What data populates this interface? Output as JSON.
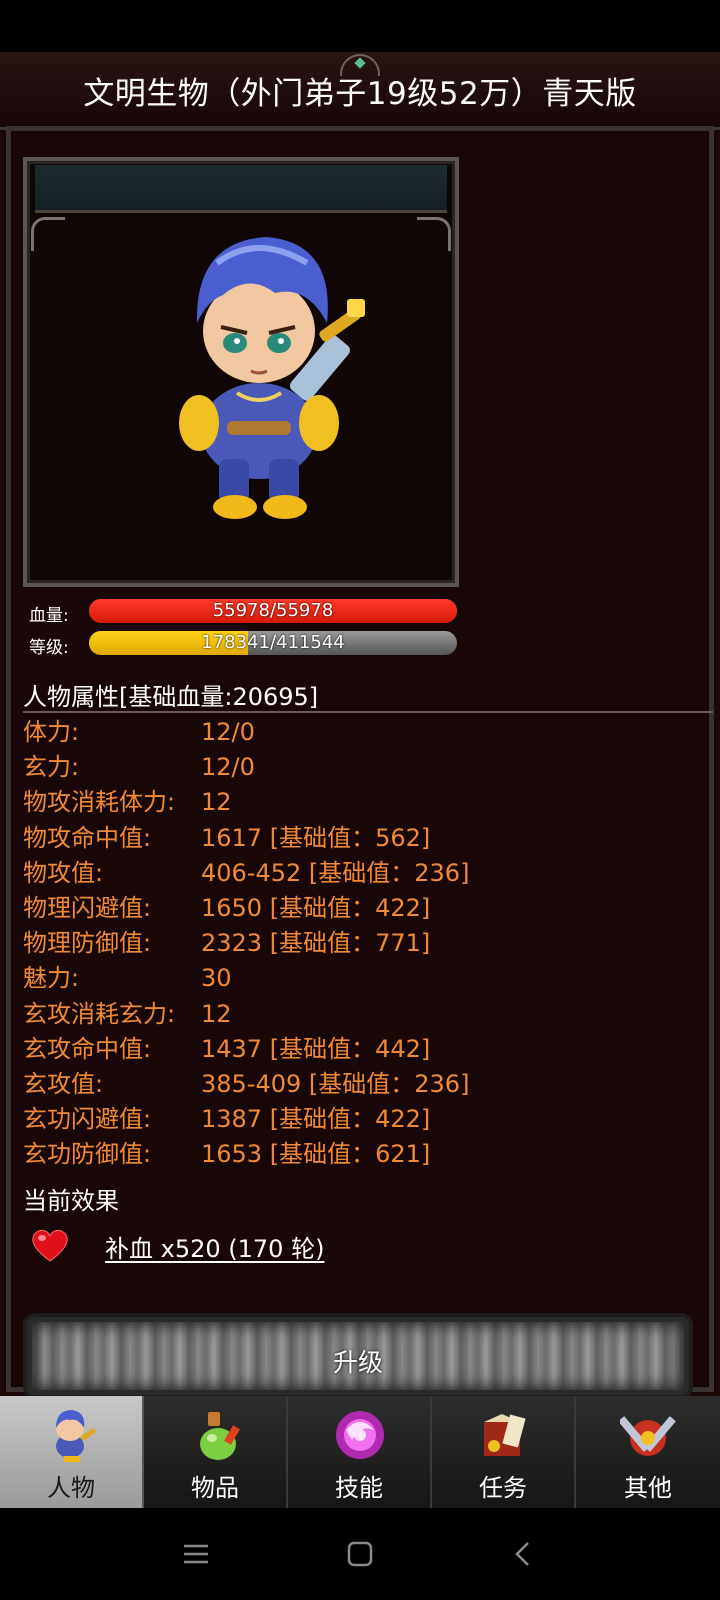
{
  "title": "文明生物（外门弟子19级52万）青天版",
  "character": {
    "hp_label": "血量:",
    "hp_value": "55978/55978",
    "hp_fraction": 1.0,
    "level_label": "等级:",
    "exp_value": "178341/411544",
    "exp_fraction": 0.433
  },
  "attributes": {
    "header": "人物属性[基础血量:20695]",
    "items": [
      {
        "name": "体力:",
        "value": "12/0"
      },
      {
        "name": "玄力:",
        "value": "12/0"
      },
      {
        "name": "物攻消耗体力:",
        "value": "12"
      },
      {
        "name": "物攻命中值:",
        "value": "1617 [基础值：562]"
      },
      {
        "name": "物攻值:",
        "value": "406-452 [基础值：236]"
      },
      {
        "name": "物理闪避值:",
        "value": "1650 [基础值：422]"
      },
      {
        "name": "物理防御值:",
        "value": "2323 [基础值：771]"
      },
      {
        "name": "魅力:",
        "value": "30"
      },
      {
        "name": "玄攻消耗玄力:",
        "value": "12"
      },
      {
        "name": "玄攻命中值:",
        "value": "1437 [基础值：442]"
      },
      {
        "name": "玄攻值:",
        "value": "385-409 [基础值：236]"
      },
      {
        "name": "玄功闪避值:",
        "value": "1387 [基础值：422]"
      },
      {
        "name": "玄功防御值:",
        "value": "1653 [基础值：621]"
      }
    ]
  },
  "effects": {
    "header": "当前效果",
    "items": [
      {
        "icon": "heart-icon",
        "text": "补血 x520 (170 轮)"
      }
    ]
  },
  "upgrade_button": "升级",
  "nav": {
    "tabs": [
      {
        "label": "人物",
        "icon": "character-icon",
        "active": true
      },
      {
        "label": "物品",
        "icon": "potion-icon",
        "active": false
      },
      {
        "label": "技能",
        "icon": "skill-orb-icon",
        "active": false
      },
      {
        "label": "任务",
        "icon": "quest-icon",
        "active": false
      },
      {
        "label": "其他",
        "icon": "other-icon",
        "active": false
      }
    ]
  },
  "colors": {
    "background": "#1c0808",
    "attribute_text": "#f08a38",
    "hp_bar": "#e02010",
    "exp_bar": "#f5c400"
  }
}
